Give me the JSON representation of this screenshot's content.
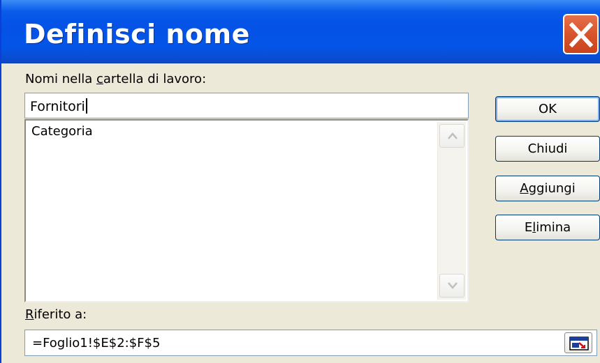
{
  "dialog": {
    "title": "Definisci nome",
    "names_label_pre": "Nomi nella ",
    "names_label_accel": "c",
    "names_label_post": "artella di lavoro:",
    "name_input_value": "Fornitori",
    "list_items": [
      "Categoria"
    ],
    "ref_label_accel": "R",
    "ref_label_post": "iferito a:",
    "ref_input_value": "=Foglio1!$E$2:$F$5"
  },
  "buttons": {
    "ok": "OK",
    "close": "Chiudi",
    "add_accel": "A",
    "add_post": "ggiungi",
    "delete_pre": "E",
    "delete_accel": "l",
    "delete_post": "imina"
  },
  "icons": {
    "close": "close-x-icon",
    "scroll_up": "chevron-up-icon",
    "scroll_down": "chevron-down-icon",
    "ref_collapse": "collapse-dialog-icon"
  },
  "colors": {
    "titlebar": "#0552e6",
    "close_button": "#d8542b",
    "dialog_bg": "#ece9d8"
  }
}
